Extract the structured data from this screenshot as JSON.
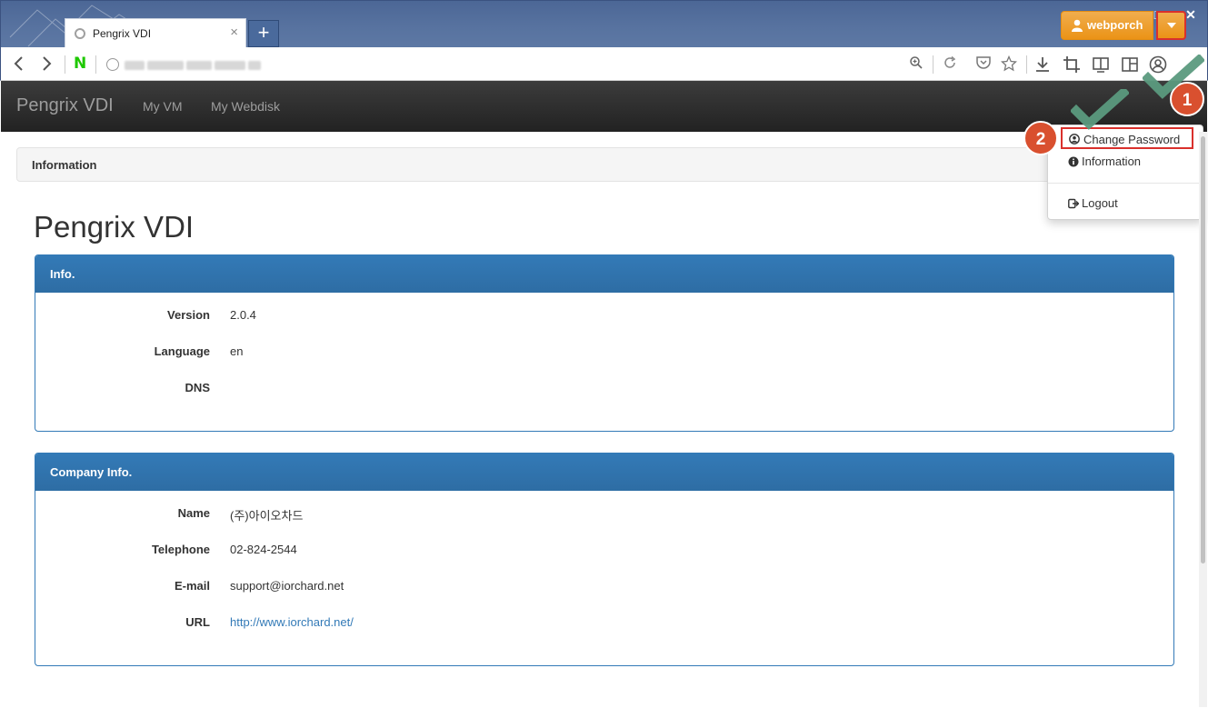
{
  "browser": {
    "tab_title": "Pengrix VDI",
    "tab_close": "×",
    "new_tab": "+",
    "naver_logo": "N",
    "window_controls": {
      "minimize": "–",
      "maximize": "□",
      "close": "✕"
    }
  },
  "navbar": {
    "brand": "Pengrix VDI",
    "links": [
      "My VM",
      "My Webdisk"
    ],
    "user_label": "webporch"
  },
  "dropdown": {
    "items": [
      "Change Password",
      "Information",
      "Logout"
    ]
  },
  "annotations": {
    "step1": "1",
    "step2": "2"
  },
  "breadcrumb": "Information",
  "page_title": "Pengrix VDI",
  "info_panel": {
    "heading": "Info.",
    "rows": [
      {
        "label": "Version",
        "value": "2.0.4"
      },
      {
        "label": "Language",
        "value": "en"
      },
      {
        "label": "DNS",
        "value": ""
      }
    ]
  },
  "company_panel": {
    "heading": "Company Info.",
    "rows": [
      {
        "label": "Name",
        "value": "(주)아이오차드"
      },
      {
        "label": "Telephone",
        "value": "02-824-2544"
      },
      {
        "label": "E-mail",
        "value": "support@iorchard.net"
      },
      {
        "label": "URL",
        "value": "http://www.iorchard.net/"
      }
    ]
  },
  "colors": {
    "primary": "#337ab7",
    "warning": "#f0ad4e",
    "danger": "#d9302c",
    "check_green": "#5b9a7e",
    "navbar_dark": "#222222"
  }
}
